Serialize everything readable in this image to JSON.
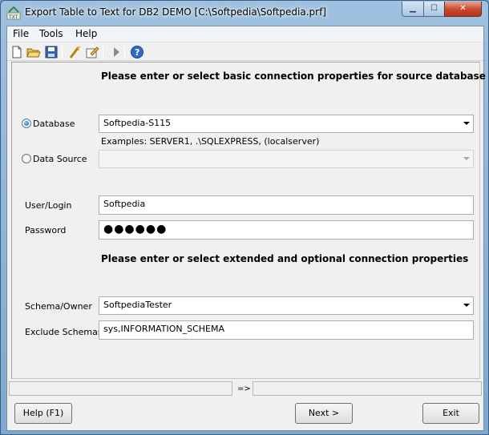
{
  "window": {
    "title": "Export Table to Text for DB2 DEMO [C:\\Softpedia\\Softpedia.prf]"
  },
  "menu": {
    "file": "File",
    "tools": "Tools",
    "help": "Help"
  },
  "toolbar": {
    "icons": [
      "new-file-icon",
      "open-folder-icon",
      "save-icon",
      "wizard-icon",
      "edit-icon",
      "run-icon",
      "help-icon"
    ]
  },
  "form": {
    "heading_basic": "Please enter or select basic connection properties for source database",
    "database_label": "Database",
    "database_value": "Softpedia-S115",
    "examples_text": "Examples: SERVER1, .\\SQLEXPRESS, (localserver)",
    "datasource_label": "Data Source",
    "datasource_value": "",
    "user_label": "User/Login",
    "user_value": "Softpedia",
    "password_label": "Password",
    "password_value": "●●●●●●",
    "heading_extended": "Please enter or select extended and optional connection properties",
    "schema_label": "Schema/Owner",
    "schema_value": "SoftpediaTester",
    "exclude_label": "Exclude Schemas",
    "exclude_value": "sys,INFORMATION_SCHEMA"
  },
  "status": {
    "arrow": "=>"
  },
  "buttons": {
    "help": "Help (F1)",
    "next": "Next >",
    "exit": "Exit"
  },
  "colors": {
    "frame": "#7ea8cf",
    "radio_selected": "#1d5fb0",
    "close_button": "#c7472e"
  }
}
